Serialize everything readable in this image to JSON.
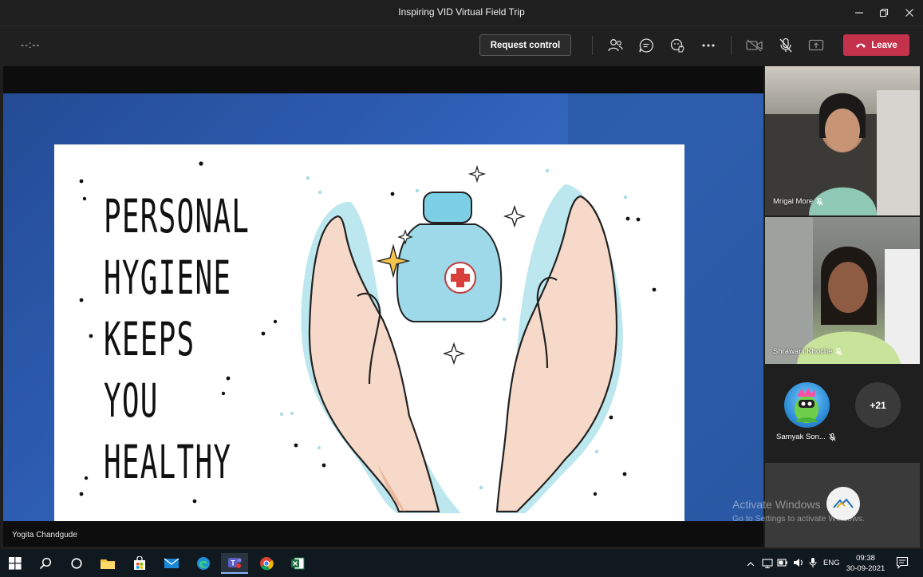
{
  "window": {
    "title": "Inspiring VID Virtual Field Trip"
  },
  "toolbar": {
    "timer": "--:--",
    "request_control_label": "Request control",
    "leave_label": "Leave",
    "leave_color": "#c4314b"
  },
  "stage": {
    "slide_lines": [
      "PERSONAL",
      "HYGIENE",
      "KEEPS",
      "YOU",
      "HEALTHY"
    ],
    "presenter": "Yogita Chandgude"
  },
  "participants": {
    "tiles": [
      {
        "name": "Mrigal More",
        "muted": true
      },
      {
        "name": "Shrawani Khoche",
        "muted": true
      }
    ],
    "avatar_tile": {
      "name": "Samyak Son...",
      "muted": true
    },
    "overflow_count": "+21"
  },
  "watermark": {
    "line1": "Activate Windows",
    "line2": "Go to Settings to activate Windows."
  },
  "taskbar": {
    "language": "ENG",
    "time": "09:38",
    "date": "30-09-2021"
  }
}
